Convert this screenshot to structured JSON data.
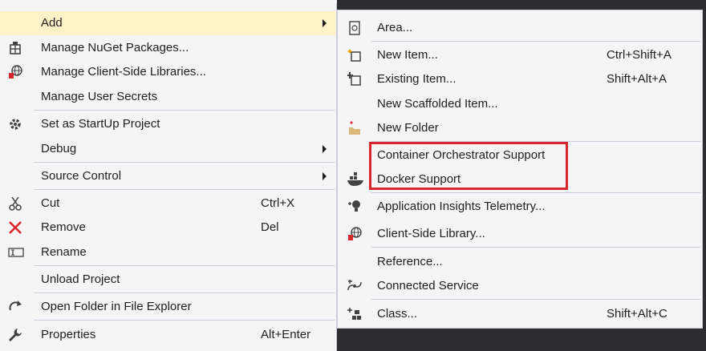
{
  "left_menu": {
    "items": [
      {
        "label": "Add",
        "icon": "add-submenu",
        "has_submenu": true,
        "highlighted": true
      },
      {
        "label": "Manage NuGet Packages...",
        "icon": "nuget-icon"
      },
      {
        "label": "Manage Client-Side Libraries...",
        "icon": "client-libs-icon"
      },
      {
        "label": "Manage User Secrets",
        "icon": ""
      },
      {
        "label": "Set as StartUp Project",
        "icon": "gear-icon"
      },
      {
        "label": "Debug",
        "icon": "",
        "has_submenu": true
      },
      {
        "label": "Source Control",
        "icon": "",
        "has_submenu": true
      },
      {
        "label": "Cut",
        "icon": "scissors-icon",
        "shortcut": "Ctrl+X"
      },
      {
        "label": "Remove",
        "icon": "delete-x-icon",
        "shortcut": "Del"
      },
      {
        "label": "Rename",
        "icon": "rename-icon"
      },
      {
        "label": "Unload Project",
        "icon": ""
      },
      {
        "label": "Open Folder in File Explorer",
        "icon": "refresh-arrow-icon"
      },
      {
        "label": "Properties",
        "icon": "wrench-icon",
        "shortcut": "Alt+Enter"
      }
    ]
  },
  "right_menu": {
    "items": [
      {
        "label": "Area...",
        "icon": "area-icon"
      },
      {
        "label": "New Item...",
        "icon": "new-item-icon",
        "shortcut": "Ctrl+Shift+A"
      },
      {
        "label": "Existing Item...",
        "icon": "existing-item-icon",
        "shortcut": "Shift+Alt+A"
      },
      {
        "label": "New Scaffolded Item...",
        "icon": ""
      },
      {
        "label": "New Folder",
        "icon": "new-folder-icon"
      },
      {
        "label": "Container Orchestrator Support",
        "icon": ""
      },
      {
        "label": "Docker Support",
        "icon": "docker-icon"
      },
      {
        "label": "Application Insights Telemetry...",
        "icon": "app-insights-icon"
      },
      {
        "label": "Client-Side Library...",
        "icon": "client-libs-icon"
      },
      {
        "label": "Reference...",
        "icon": ""
      },
      {
        "label": "Connected Service",
        "icon": "connected-service-icon"
      },
      {
        "label": "Class...",
        "icon": "class-icon",
        "shortcut": "Shift+Alt+C"
      }
    ]
  },
  "colors": {
    "menu_bg": "#f5f5f5",
    "highlight_bg": "#fff3c7",
    "annotation_red": "#d9252e",
    "separator": "#cccedb"
  }
}
